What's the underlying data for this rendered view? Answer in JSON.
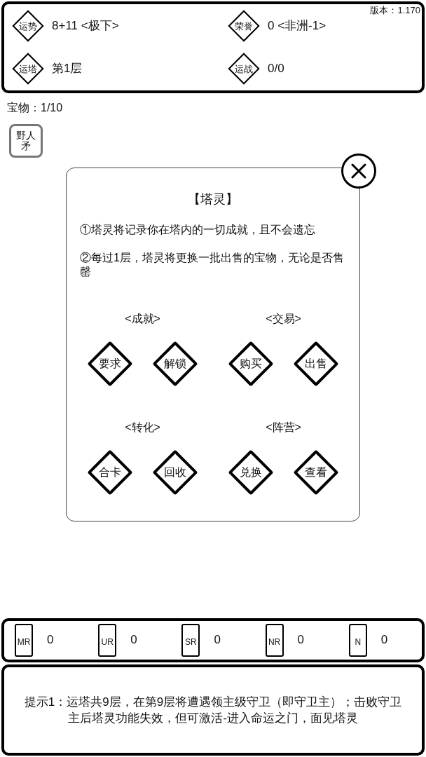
{
  "version": "版本：1.170",
  "stats": [
    {
      "label": "运势",
      "value": "8+11 <极下>"
    },
    {
      "label": "荣誉",
      "value": "0 <非洲-1>"
    },
    {
      "label": "运塔",
      "value": "第1层"
    },
    {
      "label": "运战",
      "value": "0/0"
    }
  ],
  "treasure": {
    "label": "宝物：1/10",
    "items": [
      {
        "name": "野人矛"
      }
    ]
  },
  "dialog": {
    "title": "【塔灵】",
    "paragraphs": [
      "①塔灵将记录你在塔内的一切成就，且不会遗忘",
      "②每过1层，塔灵将更换一批出售的宝物，无论是否售罄"
    ],
    "sections": [
      {
        "heading": "<成就>",
        "buttons": [
          "要求",
          "解锁"
        ]
      },
      {
        "heading": "<交易>",
        "buttons": [
          "购买",
          "出售"
        ]
      },
      {
        "heading": "<转化>",
        "buttons": [
          "合卡",
          "回收"
        ]
      },
      {
        "heading": "<阵营>",
        "buttons": [
          "兑换",
          "查看"
        ]
      }
    ]
  },
  "rarities": [
    {
      "label": "MR",
      "count": "0"
    },
    {
      "label": "UR",
      "count": "0"
    },
    {
      "label": "SR",
      "count": "0"
    },
    {
      "label": "NR",
      "count": "0"
    },
    {
      "label": "N",
      "count": "0"
    }
  ],
  "hint": "提示1：运塔共9层，在第9层将遭遇领主级守卫（即守卫主）；击败守卫主后塔灵功能失效，但可激活-进入命运之门，面见塔灵"
}
